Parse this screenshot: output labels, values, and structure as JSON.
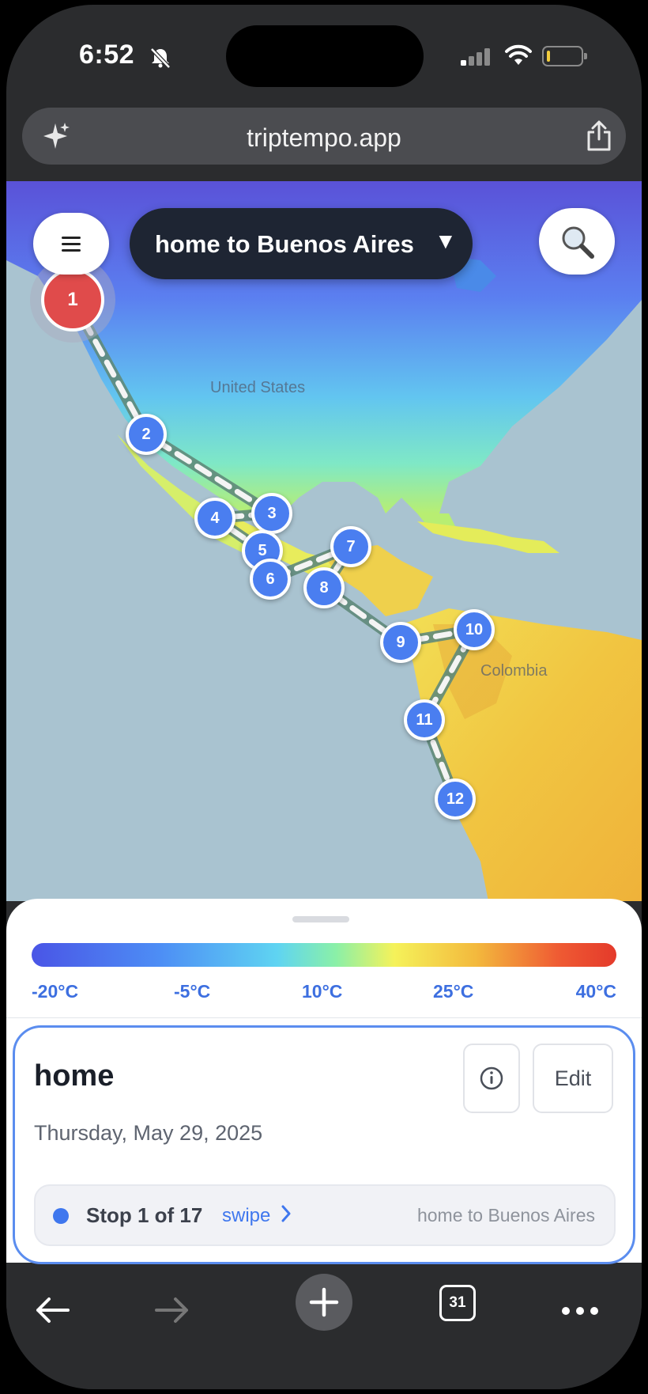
{
  "status_bar": {
    "time": "6:52"
  },
  "browser": {
    "url": "triptempo.app",
    "tabs_count": "31"
  },
  "map": {
    "trip_selector_label": "home to Buenos Aires",
    "country_labels": [
      "United States",
      "Colombia"
    ],
    "markers": [
      "1",
      "2",
      "3",
      "4",
      "5",
      "6",
      "7",
      "8",
      "9",
      "10",
      "11",
      "12"
    ]
  },
  "legend": {
    "ticks": [
      "-20°C",
      "-5°C",
      "10°C",
      "25°C",
      "40°C"
    ]
  },
  "stop_card": {
    "name": "home",
    "date": "Thursday, May 29, 2025",
    "edit_label": "Edit",
    "stop_counter": "Stop 1 of 17",
    "swipe_label": "swipe",
    "trip_name": "home to Buenos Aires"
  },
  "colors": {
    "accent": "#4a7ef0",
    "first_stop": "#e04b4b",
    "pill": "#1e2533"
  },
  "icons": [
    "sparkle-icon",
    "share-icon",
    "hamburger-icon",
    "search-icon",
    "info-icon",
    "chevron-right-icon",
    "back-icon",
    "forward-icon",
    "plus-icon",
    "tabs-icon",
    "more-icon",
    "silent-bell-icon",
    "signal-icon",
    "wifi-icon",
    "battery-icon"
  ]
}
